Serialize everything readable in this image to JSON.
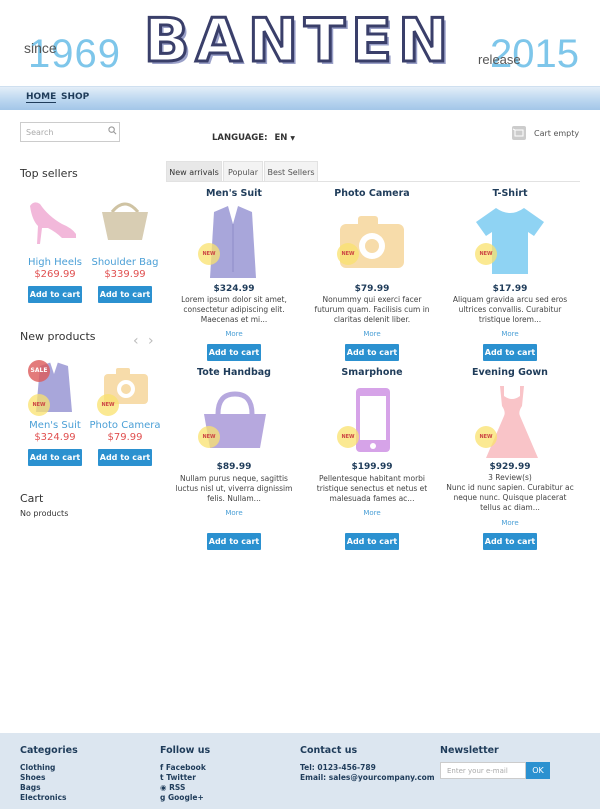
{
  "header": {
    "since": "since",
    "year_start": "1969",
    "logo_text": "BANTEN",
    "release": "release",
    "year_end": "2015"
  },
  "nav": {
    "items": [
      "HOME",
      "SHOP"
    ]
  },
  "topbar": {
    "search_placeholder": "Search",
    "language_label": "LANGUAGE:",
    "language_value": "EN",
    "cart_label": "Cart empty"
  },
  "sidebar": {
    "top_sellers_title": "Top sellers",
    "top_sellers": [
      {
        "name": "High Heels",
        "price": "$269.99",
        "button": "Add to cart"
      },
      {
        "name": "Shoulder Bag",
        "price": "$339.99",
        "button": "Add to cart"
      }
    ],
    "new_products_title": "New products",
    "new_products": [
      {
        "name": "Men's Suit",
        "price": "$324.99",
        "button": "Add to cart",
        "sale": "SALE",
        "badge": "NEW"
      },
      {
        "name": "Photo Camera",
        "price": "$79.99",
        "button": "Add to cart",
        "badge": "NEW"
      }
    ],
    "cart_title": "Cart",
    "cart_empty": "No products"
  },
  "tabs": [
    "New arrivals",
    "Popular",
    "Best Sellers"
  ],
  "products": [
    {
      "name": "Men's Suit",
      "price": "$324.99",
      "desc": "Lorem ipsum dolor sit amet, consectetur adipiscing elit. Maecenas et mi...",
      "more": "More",
      "button": "Add to cart",
      "badge": "NEW",
      "color": "#a8a6da"
    },
    {
      "name": "Photo Camera",
      "price": "$79.99",
      "desc": "Nonummy qui exerci facer futurum quam. Facilisis cum in claritas delenit liber.",
      "more": "More",
      "button": "Add to cart",
      "badge": "NEW",
      "color": "#f7dcaa"
    },
    {
      "name": "T-Shirt",
      "price": "$17.99",
      "desc": "Aliquam gravida arcu sed eros ultrices convallis. Curabitur tristique lorem...",
      "more": "More",
      "button": "Add to cart",
      "badge": "NEW",
      "color": "#8fd3f3"
    },
    {
      "name": "Tote Handbag",
      "price": "$89.99",
      "desc": "Nullam purus neque, sagittis luctus nisl ut, viverra dignissim felis. Nullam...",
      "more": "More",
      "button": "Add to cart",
      "badge": "NEW",
      "color": "#b6a8de"
    },
    {
      "name": "Smarphone",
      "price": "$199.99",
      "desc": "Pellentesque habitant morbi tristique senectus et netus et malesuada fames ac...",
      "more": "More",
      "button": "Add to cart",
      "badge": "NEW",
      "color": "#d6a3e8"
    },
    {
      "name": "Evening Gown",
      "price": "$929.99",
      "reviews": "3 Review(s)",
      "desc": "Nunc id nunc sapien. Curabitur ac neque nunc. Quisque placerat tellus ac diam...",
      "more": "More",
      "button": "Add to cart",
      "badge": "NEW",
      "color": "#f9c4c8"
    }
  ],
  "footer": {
    "categories_title": "Categories",
    "categories": [
      "Clothing",
      "Shoes",
      "Bags",
      "Electronics"
    ],
    "follow_title": "Follow us",
    "follow": [
      "Facebook",
      "Twitter",
      "RSS",
      "Google+"
    ],
    "contact_title": "Contact us",
    "tel": "Tel: 0123-456-789",
    "email": "Email: sales@yourcompany.com",
    "newsletter_title": "Newsletter",
    "newsletter_placeholder": "Enter your e-mail",
    "newsletter_button": "OK"
  },
  "colors": {
    "accent": "#2b91d0",
    "price_red": "#e05050",
    "link": "#4a9fd6",
    "dark_text": "#1f3c5a"
  }
}
